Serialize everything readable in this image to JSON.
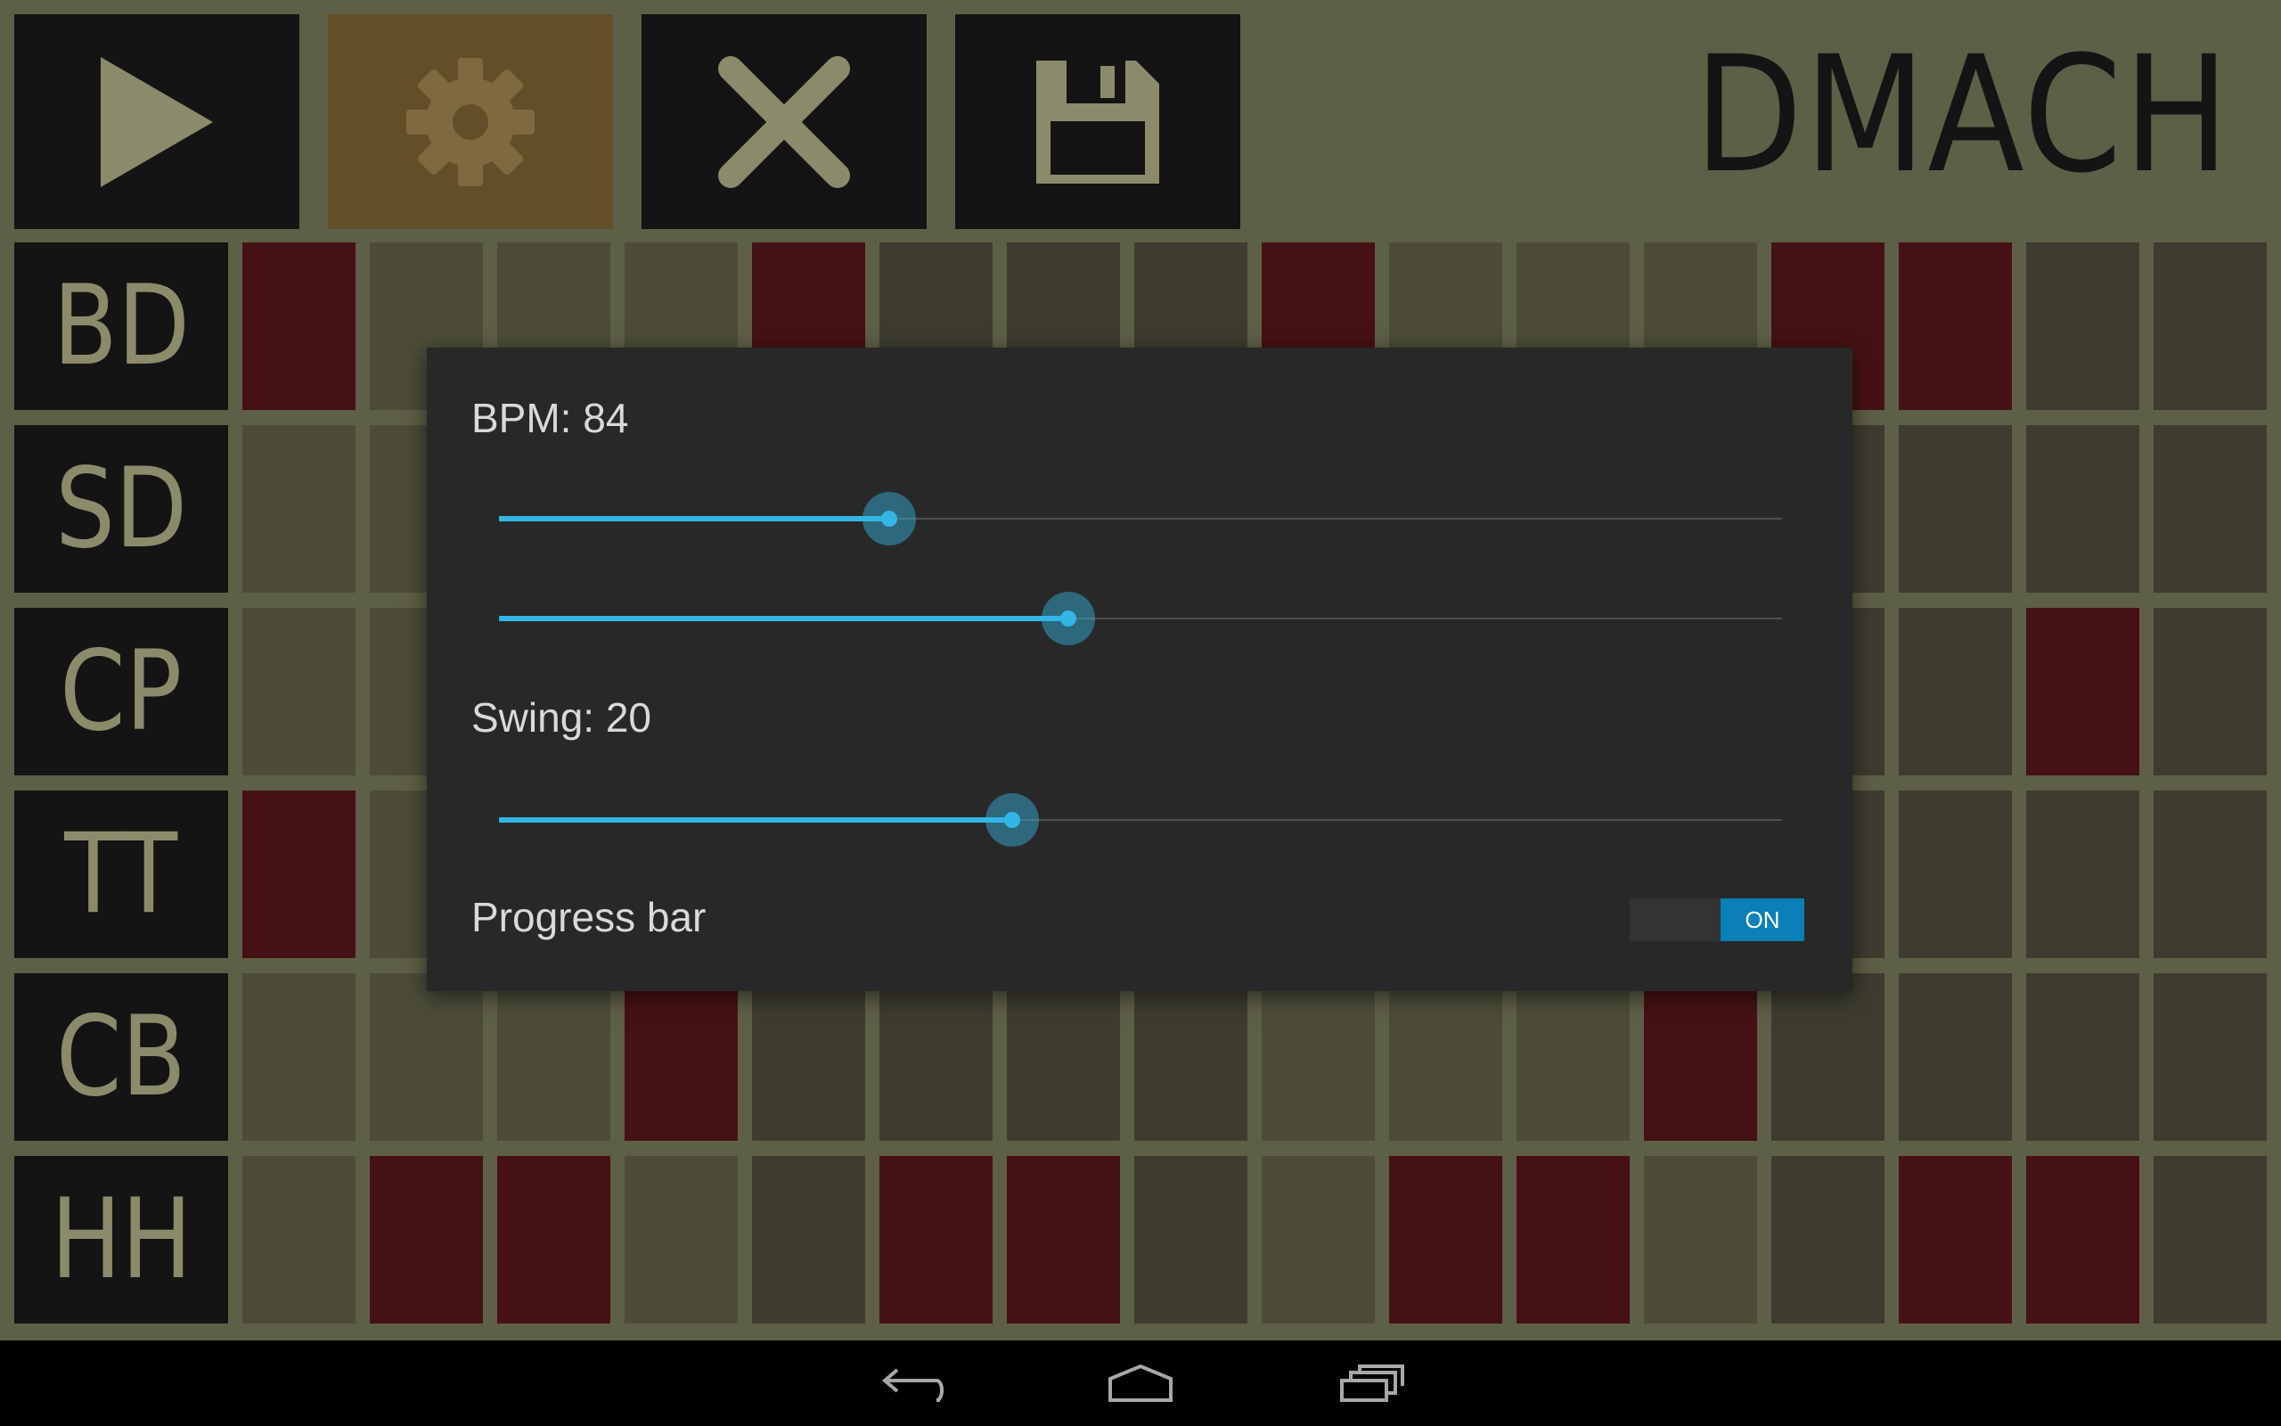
{
  "app": {
    "title": "DMACH",
    "toolbar": [
      {
        "name": "play-button",
        "icon": "play-icon",
        "active": false
      },
      {
        "name": "settings-button",
        "icon": "gear-icon",
        "active": true
      },
      {
        "name": "clear-button",
        "icon": "close-icon",
        "active": false
      },
      {
        "name": "save-button",
        "icon": "save-icon",
        "active": false
      }
    ]
  },
  "sequencer": {
    "rows": [
      {
        "label": "BD",
        "steps": [
          1,
          0,
          0,
          0,
          1,
          0,
          0,
          0,
          1,
          0,
          0,
          0,
          1,
          1,
          0,
          0
        ]
      },
      {
        "label": "SD",
        "steps": [
          0,
          0,
          0,
          0,
          0,
          0,
          0,
          0,
          0,
          0,
          0,
          0,
          0,
          0,
          0,
          0
        ]
      },
      {
        "label": "CP",
        "steps": [
          0,
          0,
          0,
          0,
          0,
          0,
          0,
          0,
          0,
          0,
          0,
          0,
          0,
          0,
          1,
          0
        ]
      },
      {
        "label": "TT",
        "steps": [
          1,
          0,
          0,
          0,
          0,
          0,
          0,
          0,
          0,
          0,
          0,
          0,
          0,
          0,
          0,
          0
        ]
      },
      {
        "label": "CB",
        "steps": [
          0,
          0,
          0,
          1,
          0,
          0,
          0,
          0,
          0,
          0,
          0,
          1,
          0,
          0,
          0,
          0
        ]
      },
      {
        "label": "HH",
        "steps": [
          0,
          1,
          1,
          0,
          0,
          1,
          1,
          0,
          0,
          1,
          1,
          0,
          0,
          1,
          1,
          0
        ]
      }
    ],
    "colors": {
      "step_on": "#461114",
      "step_off_a": "#4c4c39",
      "step_off_b": "#3d3c2f"
    }
  },
  "settings_dialog": {
    "bpm_label": "BPM: 84",
    "bpm_slider_fraction": 0.304,
    "second_slider_fraction": 0.444,
    "swing_label": "Swing: 20",
    "swing_slider_fraction": 0.4,
    "progress_bar_label": "Progress bar",
    "progress_bar_toggle": "ON",
    "accent": "#33b5e5"
  },
  "navbar": {
    "buttons": [
      "back-icon",
      "home-icon",
      "recent-apps-icon"
    ]
  }
}
